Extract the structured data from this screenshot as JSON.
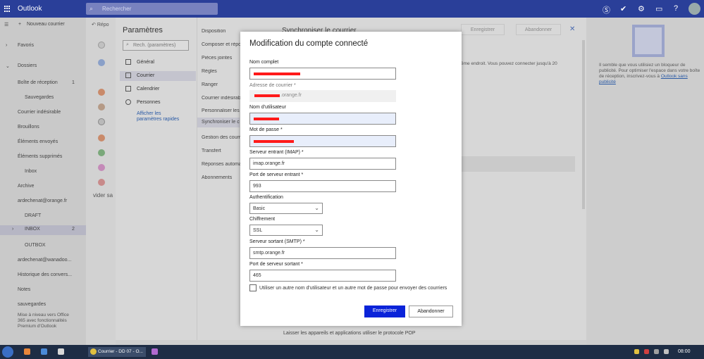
{
  "topbar": {
    "app_name": "Outlook",
    "search_placeholder": "Rechercher"
  },
  "leftnav": {
    "new_mail": "Nouveau courrier",
    "items": [
      {
        "label": "Favoris"
      },
      {
        "label": "Dossiers"
      },
      {
        "label": "Boîte de réception",
        "count": "1"
      },
      {
        "label": "Sauvegardes"
      },
      {
        "label": "Courrier indésirable"
      },
      {
        "label": "Brouillons"
      },
      {
        "label": "Éléments envoyés"
      },
      {
        "label": "Éléments supprimés"
      },
      {
        "label": "Inbox"
      },
      {
        "label": "Archive"
      },
      {
        "label": "ardechenat@orange.fr"
      },
      {
        "label": "DRAFT"
      },
      {
        "label": "INBOX",
        "count": "2"
      },
      {
        "label": "OUTBOX"
      },
      {
        "label": "ardechenat@wanadoo..."
      },
      {
        "label": "Historique des convers..."
      },
      {
        "label": "Notes"
      },
      {
        "label": "sauvegardes"
      }
    ],
    "upgrade_text": "Mise à niveau vers Office 365 avec fonctionnalités Premium d'Outlook"
  },
  "msglist": {
    "header_partial": "Répo",
    "vider_partial": "vider sa"
  },
  "settings": {
    "title": "Paramètres",
    "search_placeholder": "Rech. (paramètres)",
    "categories": [
      {
        "label": "Général",
        "icon": "gear-icon"
      },
      {
        "label": "Courrier",
        "icon": "mail-icon"
      },
      {
        "label": "Calendrier",
        "icon": "calendar-icon"
      },
      {
        "label": "Personnes",
        "icon": "people-icon"
      }
    ],
    "quick_link": "Afficher les paramètres rapides",
    "subitems": [
      "Disposition",
      "Composer et répondre",
      "Pièces jointes",
      "Règles",
      "Ranger",
      "Courrier indésirable",
      "Personnaliser les actions",
      "Synchroniser le courrier",
      "Gestion des courriers",
      "Transfert",
      "Réponses automatiques",
      "Abonnements"
    ],
    "page_title": "Synchroniser le courrier",
    "save_label": "Enregistrer",
    "cancel_label": "Abandonner",
    "partial_right_text": "ême endroit. Vous pouvez connecter jusqu'à 20",
    "pop_text": "Laisser les appareils et applications utiliser le protocole POP"
  },
  "ad": {
    "text": "Il semble que vous utilisiez un bloqueur de publicité. Pour optimiser l'espace dans votre boîte de réception, inscrivez-vous à",
    "link": "Outlook sans publicité"
  },
  "modal": {
    "title": "Modification du compte connecté",
    "full_name_label": "Nom complet",
    "email_label": "Adresse de courrier *",
    "email_domain": ".orange.fr",
    "username_label": "Nom d'utilisateur",
    "password_label": "Mot de passe *",
    "imap_label": "Serveur entrant (IMAP) *",
    "imap_value": "imap.orange.fr",
    "in_port_label": "Port de serveur entrant *",
    "in_port_value": "993",
    "auth_label": "Authentification",
    "auth_value": "Basic",
    "enc_label": "Chiffrement",
    "enc_value": "SSL",
    "smtp_label": "Serveur sortant (SMTP) *",
    "smtp_value": "smtp.orange.fr",
    "out_port_label": "Port de serveur sortant *",
    "out_port_value": "465",
    "checkbox_label": "Utiliser un autre nom d'utilisateur et un autre mot de passe pour envoyer des courriers",
    "save_label": "Enregistrer",
    "cancel_label": "Abandonner",
    "redaction_color": "#ff1a1a"
  },
  "taskbar": {
    "task_label": "Courrier - DD 07 - O...",
    "time": "08:00"
  }
}
